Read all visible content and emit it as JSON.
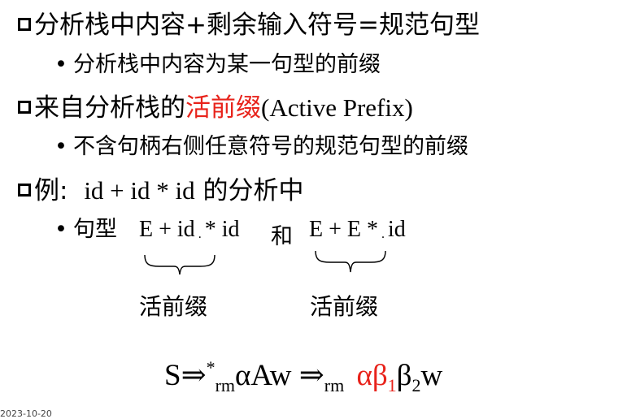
{
  "slide": {
    "line1": "分析栈中内容+剩余输入符号=规范句型",
    "line1_sub": "分析栈中内容为某一句型的前缀",
    "line2_prefix": "来自分析栈的",
    "line2_red": "活前缀",
    "line2_en": "(Active Prefix)",
    "line2_sub": "不含句柄右侧任意符号的规范句型的前缀",
    "line3_prefix": "例:",
    "line3_expr": "id + id * id",
    "line3_suffix": " 的分析中",
    "line4_label": "句型",
    "s1_a": "E + id",
    "s1_dot": ".",
    "s1_b": "* id",
    "conj": "和",
    "s2_a": "E + E *",
    "s2_dot": ".",
    "s2_b": "id",
    "brace_label_1": "活前缀",
    "brace_label_2": "活前缀"
  },
  "formula": {
    "S": "S",
    "arrow1": "⇒",
    "star": "*",
    "rm1": "rm",
    "alphaAw": "αAw ",
    "arrow2": "⇒",
    "rm2": "rm",
    "alpha_red": "αβ",
    "sub1": "1",
    "beta2": "β",
    "sub2": "2",
    "w": "w"
  },
  "footer": {
    "date": "2023-10-20"
  },
  "colors": {
    "accent_red": "#e8231b",
    "text": "#000000",
    "background": "#ffffff"
  }
}
